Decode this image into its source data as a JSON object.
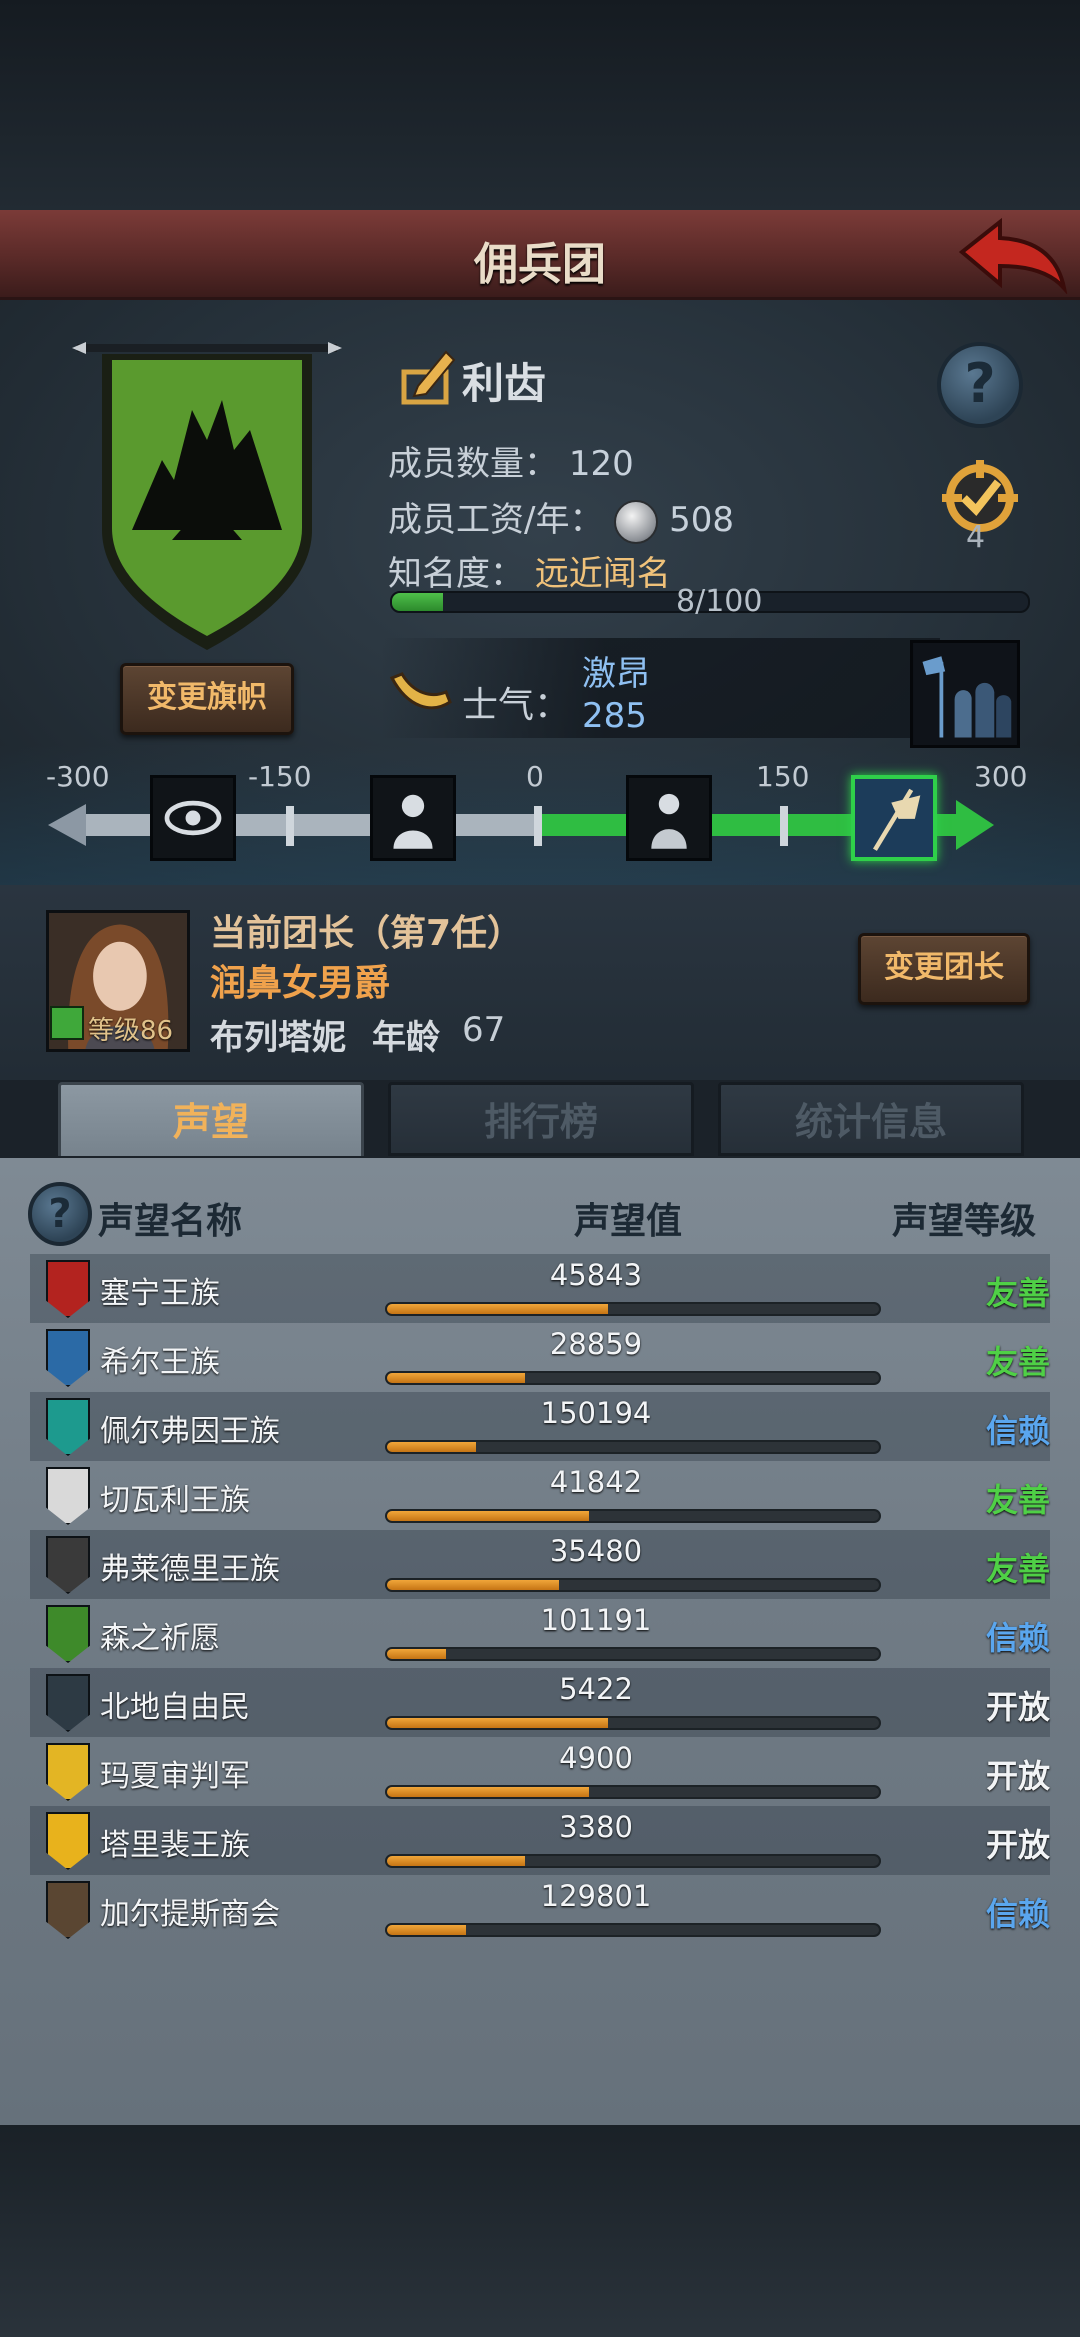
{
  "header": {
    "title": "佣兵团"
  },
  "guild": {
    "name": "利齿",
    "members_label": "成员数量：",
    "members": "120",
    "salary_label": "成员工资/年：",
    "salary": "508",
    "fame_label": "知名度：",
    "fame_rank": "远近闻名",
    "fame_progress": "8/100",
    "fame_fraction": 0.08,
    "medal_count": "4",
    "change_banner_label": "变更旗帜",
    "banner_color": "#5a9a2e"
  },
  "morale": {
    "label": "士气：",
    "state": "激昂",
    "value": "285",
    "scale_labels": [
      "-300",
      "-150",
      "0",
      "150",
      "300"
    ]
  },
  "leader": {
    "title": "当前团长（第7任）",
    "rank": "润鼻女男爵",
    "name": "布列塔妮",
    "age_label": "年龄",
    "age": "67",
    "level": "等级86",
    "change_label": "变更团长"
  },
  "tabs": [
    {
      "label": "声望",
      "active": true
    },
    {
      "label": "排行榜",
      "active": false
    },
    {
      "label": "统计信息",
      "active": false
    }
  ],
  "reputation": {
    "headers": {
      "name": "声望名称",
      "value": "声望值",
      "level": "声望等级"
    },
    "rows": [
      {
        "name": "塞宁王族",
        "value": "45843",
        "level": "友善",
        "fill": 0.45,
        "color": "#b3231f",
        "level_color": "#4fd046"
      },
      {
        "name": "希尔王族",
        "value": "28859",
        "level": "友善",
        "fill": 0.28,
        "color": "#2b6aa6",
        "level_color": "#4fd046"
      },
      {
        "name": "佩尔弗因王族",
        "value": "150194",
        "level": "信赖",
        "fill": 0.18,
        "color": "#1d9a8e",
        "level_color": "#5aa6ee"
      },
      {
        "name": "切瓦利王族",
        "value": "41842",
        "level": "友善",
        "fill": 0.41,
        "color": "#d9d9d9",
        "level_color": "#4fd046"
      },
      {
        "name": "弗莱德里王族",
        "value": "35480",
        "level": "友善",
        "fill": 0.35,
        "color": "#3a3a3a",
        "level_color": "#4fd046"
      },
      {
        "name": "森之祈愿",
        "value": "101191",
        "level": "信赖",
        "fill": 0.12,
        "color": "#3e8a2a",
        "level_color": "#5aa6ee"
      },
      {
        "name": "北地自由民",
        "value": "5422",
        "level": "开放",
        "fill": 0.45,
        "color": "#2d3a44",
        "level_color": "#f2f4f6"
      },
      {
        "name": "玛夏审判军",
        "value": "4900",
        "level": "开放",
        "fill": 0.41,
        "color": "#e3b524",
        "level_color": "#f2f4f6"
      },
      {
        "name": "塔里裴王族",
        "value": "3380",
        "level": "开放",
        "fill": 0.28,
        "color": "#e8b21c",
        "level_color": "#f2f4f6"
      },
      {
        "name": "加尔提斯商会",
        "value": "129801",
        "level": "信赖",
        "fill": 0.16,
        "color": "#5a4632",
        "level_color": "#5aa6ee"
      }
    ]
  }
}
